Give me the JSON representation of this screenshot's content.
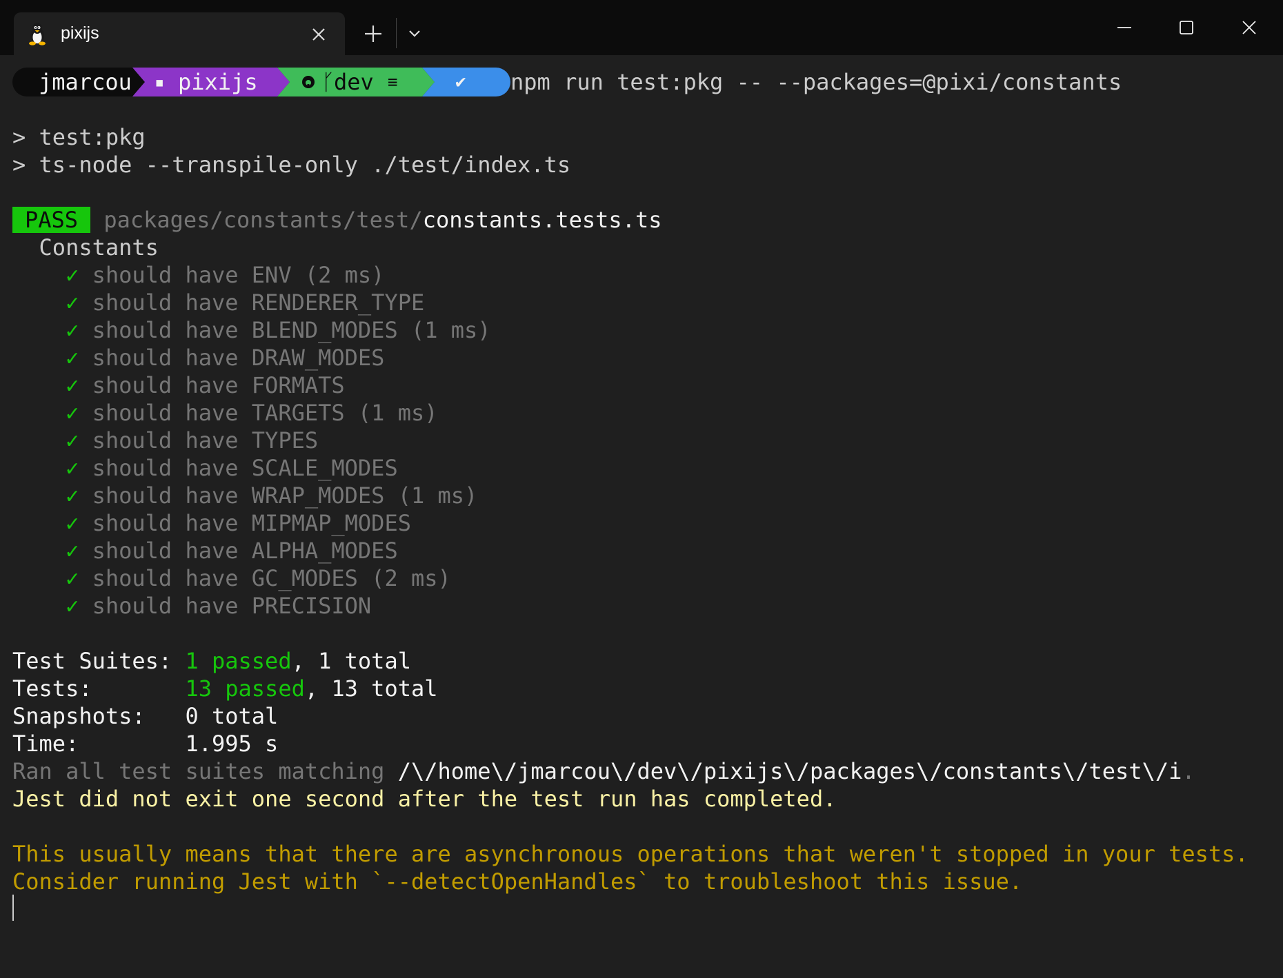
{
  "titlebar": {
    "tab_title": "pixijs",
    "icons": {
      "tab": "linux-penguin-icon",
      "close_tab": "close-icon",
      "new_tab": "plus-icon",
      "dropdown": "chevron-down-icon",
      "minimize": "minimize-icon",
      "maximize": "maximize-icon",
      "close_window": "close-icon"
    }
  },
  "prompt": {
    "user": "jmarcou",
    "folder_icon": "▪",
    "folder": "pixijs",
    "git_icon": "github-icon",
    "branch_icon": "ᚴ",
    "branch": "dev",
    "branch_status": "≡",
    "status_icon": "✔",
    "colors": {
      "user_bg": "#0c0c0c",
      "folder_bg": "#8c35c8",
      "git_bg": "#3fbc59",
      "status_bg": "#3b8eea"
    }
  },
  "command": "npm run test:pkg -- --packages=@pixi/constants",
  "script_lines": [
    "> test:pkg",
    "> ts-node --transpile-only ./test/index.ts"
  ],
  "result": {
    "badge": "PASS",
    "path_dir": "packages/constants/test/",
    "path_file": "constants.tests.ts",
    "suite": "Constants"
  },
  "tests": [
    {
      "check": "✓",
      "name": "should have ENV (2 ms)"
    },
    {
      "check": "✓",
      "name": "should have RENDERER_TYPE"
    },
    {
      "check": "✓",
      "name": "should have BLEND_MODES (1 ms)"
    },
    {
      "check": "✓",
      "name": "should have DRAW_MODES"
    },
    {
      "check": "✓",
      "name": "should have FORMATS"
    },
    {
      "check": "✓",
      "name": "should have TARGETS (1 ms)"
    },
    {
      "check": "✓",
      "name": "should have TYPES"
    },
    {
      "check": "✓",
      "name": "should have SCALE_MODES"
    },
    {
      "check": "✓",
      "name": "should have WRAP_MODES (1 ms)"
    },
    {
      "check": "✓",
      "name": "should have MIPMAP_MODES"
    },
    {
      "check": "✓",
      "name": "should have ALPHA_MODES"
    },
    {
      "check": "✓",
      "name": "should have GC_MODES (2 ms)"
    },
    {
      "check": "✓",
      "name": "should have PRECISION"
    }
  ],
  "summary": {
    "suites_label": "Test Suites: ",
    "suites_passed": "1 passed",
    "suites_total": ", 1 total",
    "tests_label": "Tests:       ",
    "tests_passed": "13 passed",
    "tests_total": ", 13 total",
    "snapshots_label": "Snapshots:   ",
    "snapshots_value": "0 total",
    "time_label": "Time:        ",
    "time_value": "1.995 s",
    "ran_prefix": "Ran all test suites matching ",
    "ran_pattern": "/\\/home\\/jmarcou\\/dev\\/pixijs\\/packages\\/constants\\/test\\/i",
    "ran_suffix": "."
  },
  "warnings": {
    "jest_exit": "Jest did not exit one second after the test run has completed.",
    "async_1": "This usually means that there are asynchronous operations that weren't stopped in your tests.",
    "async_2": "Consider running Jest with `--detectOpenHandles` to troubleshoot this issue."
  }
}
